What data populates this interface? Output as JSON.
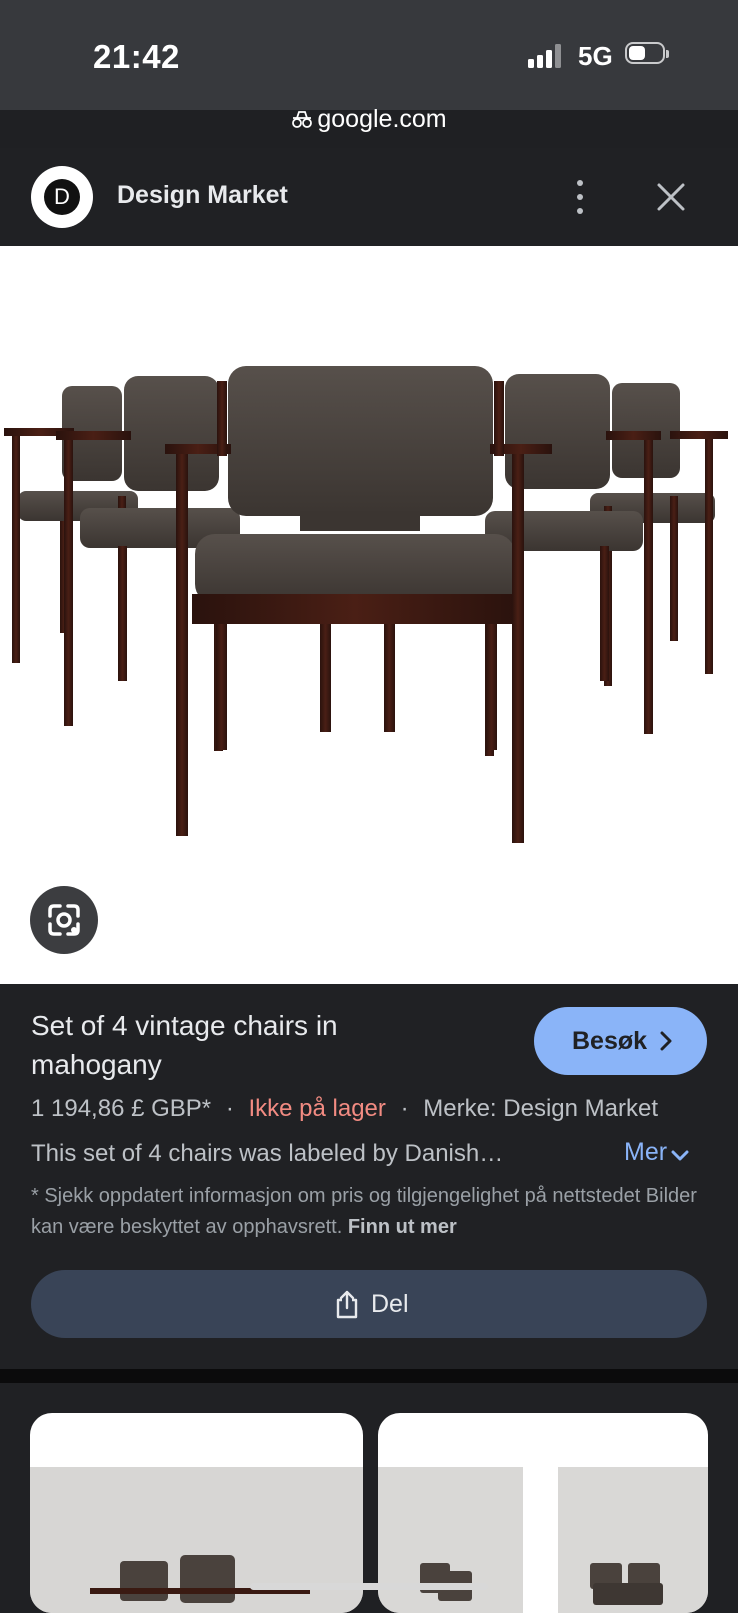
{
  "status_bar": {
    "time": "21:42",
    "network": "5G"
  },
  "browser": {
    "url": "google.com"
  },
  "site": {
    "logo_letter": "D",
    "name": "Design Market"
  },
  "product": {
    "title": "Set of 4 vintage chairs in mahogany",
    "visit_label": "Besøk",
    "price": "1 194,86 £ GBP*",
    "separator": "·",
    "stock": "Ikke på lager",
    "brand": "Merke: Design Market",
    "description": "This set of 4 chairs was labeled by Danish…",
    "more_label": "Mer",
    "disclaimer": "* Sjekk oppdatert informasjon om pris og tilgjengelighet på nettstedet Bilder kan være beskyttet av opphavsrett.",
    "learn_more": "Finn ut mer",
    "share_label": "Del"
  },
  "colors": {
    "accent": "#8ab4f8",
    "out_of_stock": "#f28b82",
    "share_button": "#394457",
    "background": "#202124",
    "status_bar": "#37393d"
  },
  "icons": {
    "lock": "lock-icon",
    "menu": "more-vert-icon",
    "close": "close-icon",
    "lens": "google-lens-icon",
    "chevron_right": "chevron-right-icon",
    "chevron_down": "chevron-down-icon",
    "share": "share-icon"
  }
}
